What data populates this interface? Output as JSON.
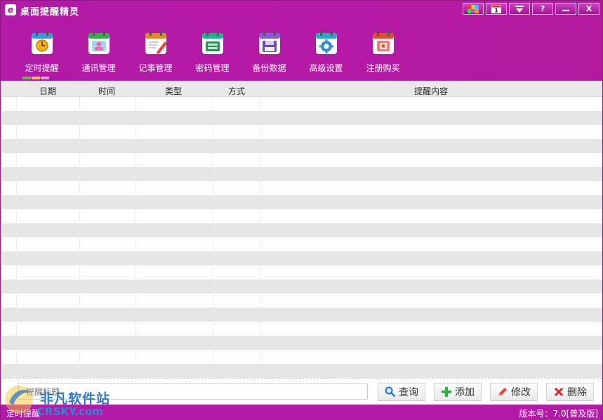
{
  "app": {
    "title": "桌面提醒精灵",
    "logo_glyph": "e"
  },
  "window_buttons": [
    {
      "name": "skin",
      "icon": "color-palette-icon"
    },
    {
      "name": "calendar",
      "icon": "calendar-1-icon",
      "text": "1"
    },
    {
      "name": "menu",
      "icon": "dropdown-arrow-icon"
    },
    {
      "name": "help",
      "icon": "help-icon",
      "text": "?"
    },
    {
      "name": "minimize",
      "icon": "minimize-icon"
    },
    {
      "name": "close",
      "icon": "close-icon",
      "text": "X"
    }
  ],
  "toolbar": {
    "items": [
      {
        "label": "定时提醒",
        "icon": "alarm-clock-icon",
        "color": "#3a9ad9"
      },
      {
        "label": "通讯管理",
        "icon": "contacts-icon",
        "color": "#2fae4a"
      },
      {
        "label": "记事管理",
        "icon": "notepad-pencil-icon",
        "color": "#e08a2a"
      },
      {
        "label": "密码管理",
        "icon": "password-icon",
        "color": "#22b08a"
      },
      {
        "label": "备份数据",
        "icon": "backup-disk-icon",
        "color": "#8a5ad0"
      },
      {
        "label": "高级设置",
        "icon": "settings-gear-icon",
        "color": "#2aa9c9"
      },
      {
        "label": "注册购买",
        "icon": "register-buy-icon",
        "color": "#e0502a"
      }
    ]
  },
  "table": {
    "columns": [
      "日期",
      "时间",
      "类型",
      "方式",
      "提醒内容"
    ],
    "rows": []
  },
  "search": {
    "placeholder": "提醒标题"
  },
  "actions": {
    "query": "查询",
    "add": "添加",
    "edit": "修改",
    "delete": "删除"
  },
  "status": {
    "left": "定时提醒",
    "version": "版本号：7.0[普及版]"
  },
  "watermark": {
    "cn": "非凡软件站",
    "en": "CRSKY.com"
  },
  "colors": {
    "brand": "#b21aa7",
    "accent_green": "#2fae4a"
  }
}
